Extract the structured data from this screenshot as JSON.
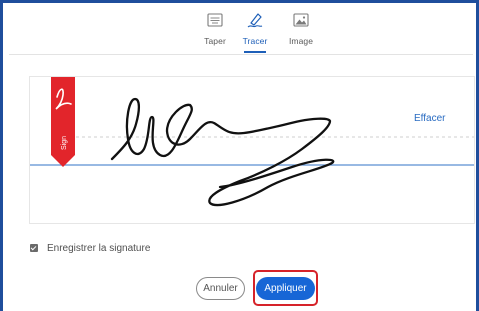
{
  "tabs": [
    {
      "label": "Taper",
      "icon": "keyboard-icon",
      "active": false
    },
    {
      "label": "Tracer",
      "icon": "pen-icon",
      "active": true
    },
    {
      "label": "Image",
      "icon": "image-icon",
      "active": false
    }
  ],
  "canvas": {
    "badge_text": "Sign",
    "clear_label": "Effacer"
  },
  "save_signature": {
    "label": "Enregistrer la signature",
    "checked": true
  },
  "buttons": {
    "cancel_label": "Annuler",
    "apply_label": "Appliquer"
  },
  "colors": {
    "accent": "#1e5fb8",
    "primary_button": "#1766d6",
    "badge": "#e2252b",
    "highlight": "#d6232a",
    "frame": "#1f4e9c"
  }
}
